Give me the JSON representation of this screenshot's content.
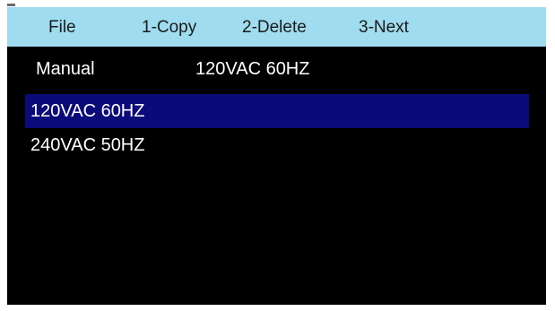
{
  "menubar": {
    "items": [
      {
        "label": "File"
      },
      {
        "label": "1-Copy"
      },
      {
        "label": "2-Delete"
      },
      {
        "label": "3-Next"
      }
    ]
  },
  "header": {
    "mode_label": "Manual",
    "current_profile": "120VAC 60HZ"
  },
  "profiles": {
    "items": [
      {
        "label": "120VAC 60HZ",
        "selected": true
      },
      {
        "label": "240VAC 50HZ",
        "selected": false
      }
    ]
  },
  "colors": {
    "menubar_bg": "#9fdcef",
    "screen_bg": "#000000",
    "selection_bg": "#0a0a7a",
    "text_light": "#ffffff",
    "text_dark": "#1a1a1a"
  }
}
